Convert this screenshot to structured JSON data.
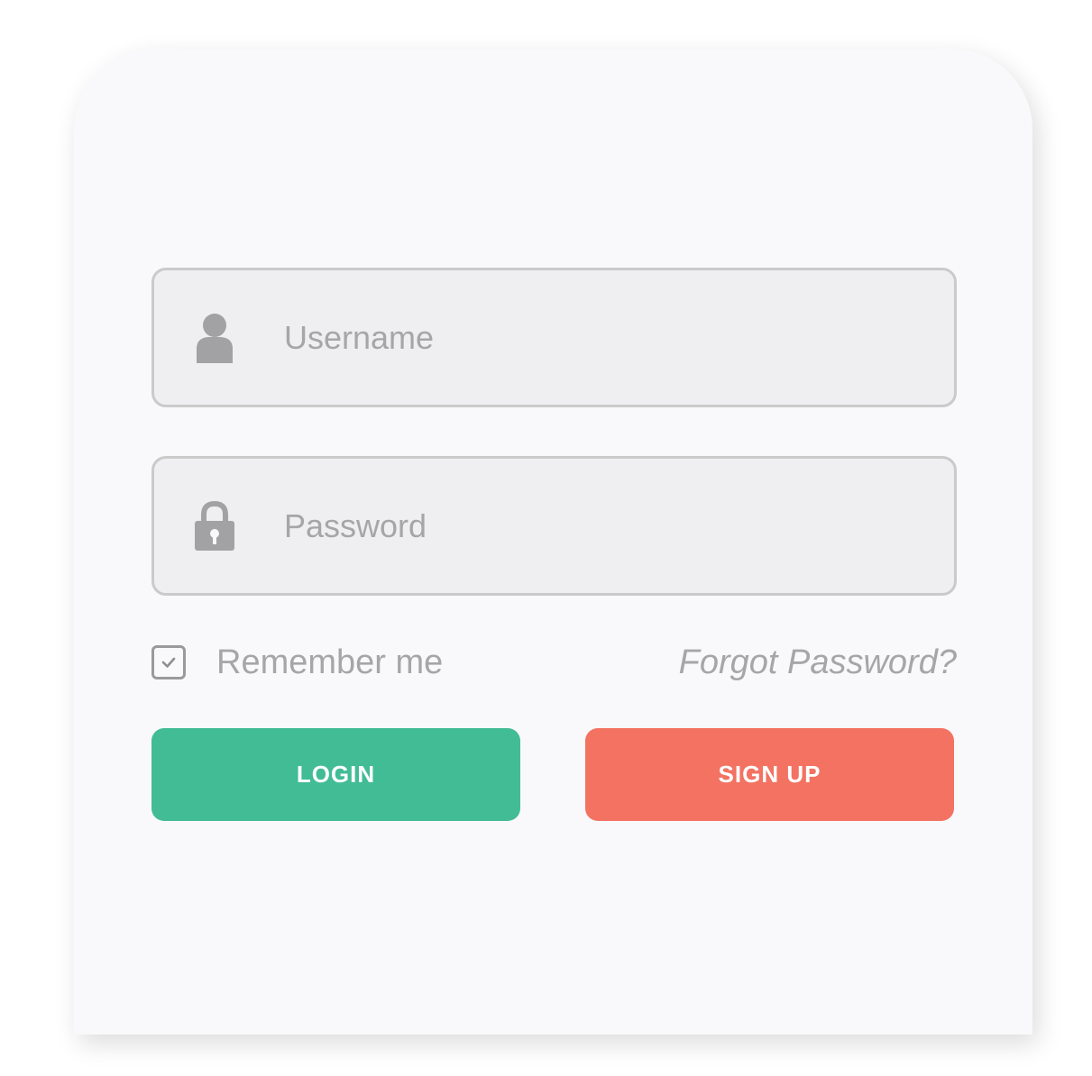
{
  "form": {
    "username": {
      "placeholder": "Username",
      "value": "",
      "icon": "user-icon"
    },
    "password": {
      "placeholder": "Password",
      "value": "",
      "icon": "lock-icon"
    },
    "remember_me": {
      "label": "Remember me",
      "checked": true
    },
    "forgot_password_label": "Forgot Password?",
    "login_label": "LOGIN",
    "signup_label": "SIGN UP"
  },
  "colors": {
    "card_background": "#f9f9fb",
    "field_background": "#efeff1",
    "field_border": "#cacaca",
    "muted_text": "#a6a6a8",
    "login_button": "#42bc94",
    "signup_button": "#f37262"
  }
}
